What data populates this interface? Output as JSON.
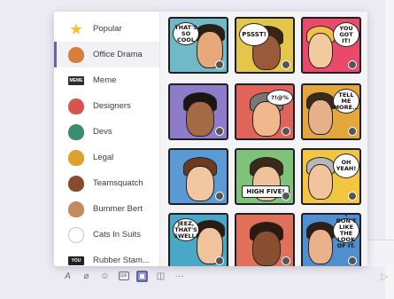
{
  "stickers_panel": {
    "categories": [
      {
        "label": "Popular",
        "icon": "star-icon",
        "color": "#f2c12e",
        "active": false
      },
      {
        "label": "Office Drama",
        "icon": "office-drama-icon",
        "color": "#d87d3a",
        "active": true
      },
      {
        "label": "Meme",
        "icon": "meme-icon",
        "color": "#2b2b33",
        "active": false
      },
      {
        "label": "Designers",
        "icon": "designers-icon",
        "color": "#d9534f",
        "active": false
      },
      {
        "label": "Devs",
        "icon": "devs-icon",
        "color": "#3c8d6e",
        "active": false
      },
      {
        "label": "Legal",
        "icon": "legal-icon",
        "color": "#e0a030",
        "active": false
      },
      {
        "label": "Teamsquatch",
        "icon": "teamsquatch-icon",
        "color": "#8a4b2c",
        "active": false
      },
      {
        "label": "Bummer Bert",
        "icon": "bummer-bert-icon",
        "color": "#c48a5a",
        "active": false
      },
      {
        "label": "Cats In Suits",
        "icon": "cats-in-suits-icon",
        "color": "#c9c6cf",
        "active": false
      },
      {
        "label": "Rubber Stam...",
        "icon": "rubber-stamp-icon",
        "color": "#1f1f25",
        "active": false
      }
    ],
    "meme_icon_text": "MEME",
    "rubber_stamp_icon_text": "YOU",
    "stickers": [
      {
        "bubble": "THAT'S SO COOL",
        "bg": "#6fb9c9",
        "skin": "#e8a97a",
        "hair": "#2b1f14"
      },
      {
        "bubble": "PSSST!",
        "bg": "#e3c64a",
        "skin": "#9a5a3a",
        "hair": "#3a2416"
      },
      {
        "bubble": "YOU GOT IT!",
        "bg": "#e94a6a",
        "skin": "#f3c9a0",
        "hair": "#f1c04a"
      },
      {
        "bubble": "",
        "bg": "#8e7bc9",
        "skin": "#a36a44",
        "hair": "#1c1410"
      },
      {
        "bubble": "?!@%",
        "bg": "#e0645a",
        "skin": "#f0b88c",
        "hair": "#7a7876"
      },
      {
        "bubble": "TELL ME MORE...",
        "bg": "#e4a73c",
        "skin": "#e6b08a",
        "hair": "#3b2a1c"
      },
      {
        "bubble": "",
        "bg": "#5b9bd5",
        "skin": "#f1c7a2",
        "hair": "#6b3a1f"
      },
      {
        "bubble": "HIGH FIVE!",
        "bg": "#7fc27a",
        "skin": "#f0c29c",
        "hair": "#3a2a1a"
      },
      {
        "bubble": "OH YEAH!",
        "bg": "#f2c640",
        "skin": "#f3c39c",
        "hair": "#b7b7b7"
      },
      {
        "bubble": "JEEZ, THAT'S SWELL!",
        "bg": "#4aa8c7",
        "skin": "#f1c39c",
        "hair": "#2a1c12"
      },
      {
        "bubble": "",
        "bg": "#e0705a",
        "skin": "#8a4f30",
        "hair": "#2b1a10"
      },
      {
        "bubble": "I DON'T LIKE THE LOOK OF IT.",
        "bg": "#4f8fd0",
        "skin": "#e9b28b",
        "hair": "#2e1f16"
      }
    ]
  },
  "toolbar": {
    "icons": [
      "format-icon",
      "attach-icon",
      "emoji-icon",
      "gif-icon",
      "sticker-icon",
      "meet-now-icon",
      "more-options-icon"
    ],
    "format_glyph": "A",
    "attach_glyph": "⌀",
    "emoji_glyph": "☺",
    "gif_label": "GIF",
    "sticker_glyph": "▣",
    "meet_glyph": "◫",
    "more_glyph": "···",
    "send_glyph": "▷"
  }
}
